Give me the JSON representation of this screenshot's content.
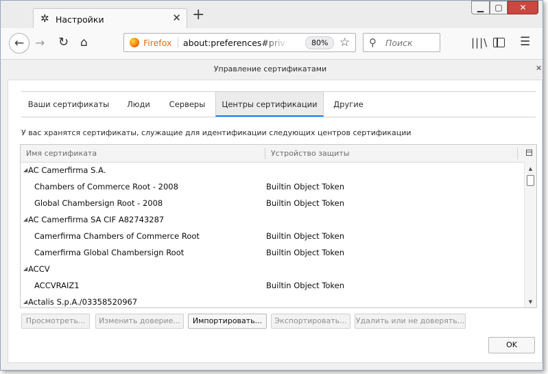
{
  "browser": {
    "tab_title": "Настройки",
    "new_tab_glyph": "+",
    "firefox_label": "Firefox",
    "url": "about:preferences#privacy",
    "zoom": "80%",
    "search_placeholder": "Поиск"
  },
  "sheet": {
    "title": "Управление сертификатами"
  },
  "dialog": {
    "tabs": [
      "Ваши сертификаты",
      "Люди",
      "Серверы",
      "Центры сертификации",
      "Другие"
    ],
    "selected_tab": 3,
    "intro": "У вас хранятся сертификаты, служащие для идентификации следующих центров сертификации",
    "columns": [
      "Имя сертификата",
      "Устройство защиты"
    ],
    "rows": [
      {
        "type": "group",
        "name": "AC Camerfirma S.A.",
        "device": ""
      },
      {
        "type": "child",
        "name": "Chambers of Commerce Root - 2008",
        "device": "Builtin Object Token"
      },
      {
        "type": "child",
        "name": "Global Chambersign Root - 2008",
        "device": "Builtin Object Token"
      },
      {
        "type": "group",
        "name": "AC Camerfirma SA CIF A82743287",
        "device": ""
      },
      {
        "type": "child",
        "name": "Camerfirma Chambers of Commerce Root",
        "device": "Builtin Object Token"
      },
      {
        "type": "child",
        "name": "Camerfirma Global Chambersign Root",
        "device": "Builtin Object Token"
      },
      {
        "type": "group",
        "name": "ACCV",
        "device": ""
      },
      {
        "type": "child",
        "name": "ACCVRAIZ1",
        "device": "Builtin Object Token"
      },
      {
        "type": "group",
        "name": "Actalis S.p.A./03358520967",
        "device": ""
      }
    ],
    "buttons": {
      "view": "Просмотреть...",
      "edit_trust": "Изменить доверие...",
      "import": "Импортировать...",
      "export": "Экспортировать...",
      "delete": "Удалить или не доверять...",
      "ok": "OK"
    }
  },
  "icons": {
    "tab": "gear-icon",
    "back": "back-arrow-icon",
    "forward": "forward-arrow-icon",
    "reload": "reload-icon",
    "home": "home-icon",
    "bookmark": "star-icon",
    "search": "search-icon",
    "library": "library-icon",
    "sidebar": "sidebar-icon",
    "menu": "hamburger-menu-icon"
  },
  "colors": {
    "selected_tab_underline": "#0a84ff",
    "close_button": "#c9483f",
    "firefox_label": "#e56a1a"
  }
}
